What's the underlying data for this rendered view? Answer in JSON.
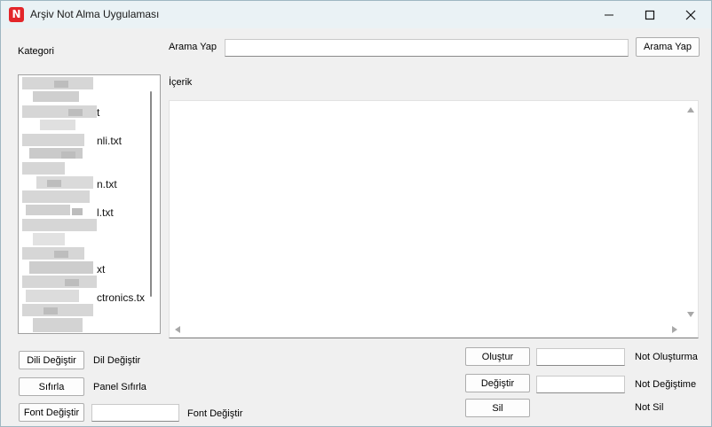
{
  "window": {
    "title": "Arşiv Not Alma Uygulaması",
    "app_icon_letter": "N"
  },
  "left_panel": {
    "category_label": "Kategori",
    "file_list": [
      {
        "visible_text": "",
        "row": 0
      },
      {
        "visible_text": "t",
        "row": 1
      },
      {
        "visible_text": "nli.txt",
        "row": 2
      },
      {
        "visible_text": "",
        "row": 3
      },
      {
        "visible_text": "n.txt",
        "row": 4
      },
      {
        "visible_text": "l.txt",
        "row": 5
      },
      {
        "visible_text": "",
        "row": 6
      },
      {
        "visible_text": "xt",
        "row": 7
      },
      {
        "visible_text": "ctronics.tx",
        "row": 8
      }
    ]
  },
  "search": {
    "label": "Arama Yap",
    "input_value": "",
    "button_label": "Arama Yap"
  },
  "content": {
    "label": "İçerik",
    "text": ""
  },
  "bottom_left": {
    "language_button": "Dili Değiştir",
    "language_label": "Dil Değiştir",
    "reset_button": "Sıfırla",
    "reset_label": "Panel Sıfırla",
    "font_button": "Font Değiştir",
    "font_input_value": "",
    "font_label": "Font Değiştir"
  },
  "bottom_right": {
    "create_button": "Oluştur",
    "create_input_value": "",
    "create_label": "Not Oluşturma",
    "edit_button": "Değiştir",
    "edit_input_value": "",
    "edit_label": "Not Değiştime",
    "delete_button": "Sil",
    "delete_label": "Not Sil"
  },
  "colors": {
    "app_icon_red": "#e3262a",
    "titlebar": "#eaf2f5",
    "window_bg": "#f0f0f0"
  }
}
